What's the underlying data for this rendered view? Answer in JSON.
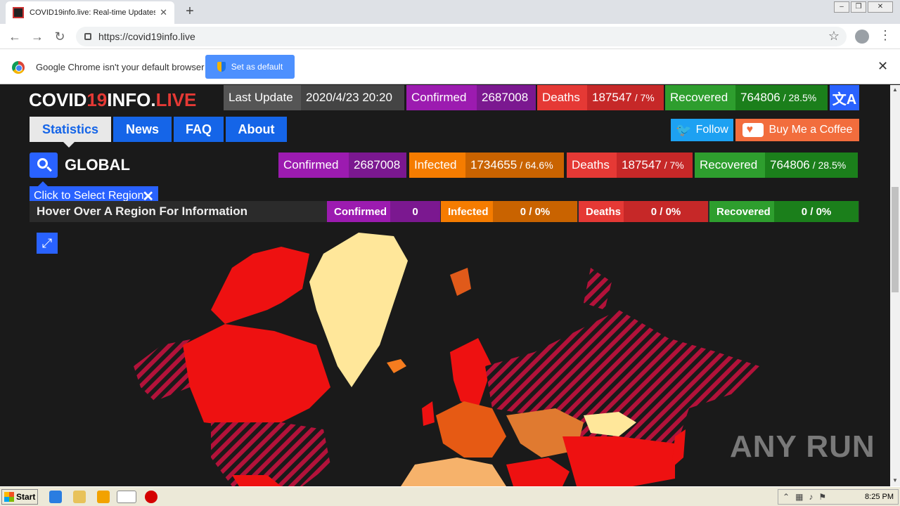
{
  "browser": {
    "tab_title": "COVID19info.live: Real-time Updates",
    "url": "https://covid19info.live",
    "infobar_text": "Google Chrome isn't your default browser",
    "set_default_label": "Set as default"
  },
  "site": {
    "logo_a": "COVID",
    "logo_b": "19",
    "logo_c": "INFO.",
    "logo_d": "LIVE",
    "header": {
      "last_update_label": "Last Update",
      "last_update_value": "2020/4/23 20:20",
      "confirmed_label": "Confirmed",
      "confirmed_value": "2687008",
      "deaths_label": "Deaths",
      "deaths_value": "187547",
      "deaths_pct": "/ 7%",
      "recovered_label": "Recovered",
      "recovered_value": "764806",
      "recovered_pct": "/ 28.5%"
    },
    "nav": {
      "statistics": "Statistics",
      "news": "News",
      "faq": "FAQ",
      "about": "About"
    },
    "twitter_label": "Follow",
    "coffee_label": "Buy Me a Coffee",
    "region": "GLOBAL",
    "global": {
      "confirmed_label": "Confirmed",
      "confirmed_value": "2687008",
      "infected_label": "Infected",
      "infected_value": "1734655",
      "infected_pct": "/ 64.6%",
      "deaths_label": "Deaths",
      "deaths_value": "187547",
      "deaths_pct": "/ 7%",
      "recovered_label": "Recovered",
      "recovered_value": "764806",
      "recovered_pct": "/ 28.5%"
    },
    "tooltip": "Click to Select Region",
    "hover": {
      "text": "Hover Over A Region For Information",
      "confirmed_label": "Confirmed",
      "confirmed_value": "0",
      "infected_label": "Infected",
      "infected_value": "0 / 0%",
      "deaths_label": "Deaths",
      "deaths_value": "0 / 0%",
      "recovered_label": "Recovered",
      "recovered_value": "0 / 0%"
    }
  },
  "watermark": "ANY RUN",
  "taskbar": {
    "start": "Start",
    "clock": "8:25 PM"
  },
  "colors": {
    "confirmed": "#9c1bb0",
    "confirmed_dark": "#7b1890",
    "infected": "#f57c00",
    "infected_dark": "#c96300",
    "deaths": "#e53935",
    "deaths_dark": "#c62828",
    "recovered": "#2e9e2e",
    "recovered_dark": "#1b7f1b",
    "accent": "#2962ff"
  }
}
